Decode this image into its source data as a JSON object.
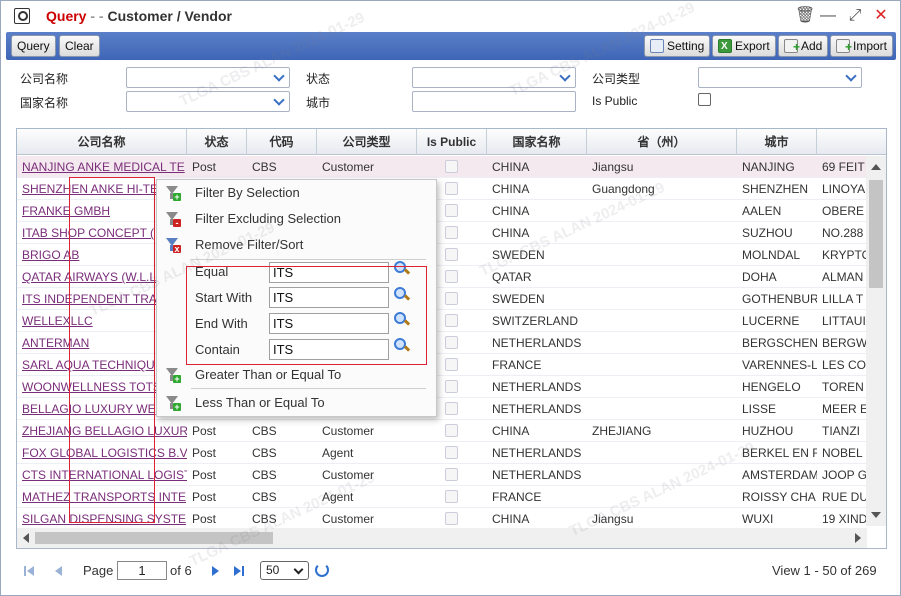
{
  "window": {
    "title_query": "Query",
    "title_sep": "- -",
    "title_rest": "Customer / Vendor",
    "ctrl_trash": "🗑",
    "ctrl_min": "—",
    "ctrl_max": "⤢",
    "ctrl_close": "✕"
  },
  "toolbar": {
    "query": "Query",
    "clear": "Clear",
    "setting": "Setting",
    "export": "Export",
    "add": "Add",
    "import": "Import"
  },
  "filters": {
    "company_name": "公司名称",
    "status": "状态",
    "company_type": "公司类型",
    "country_name": "国家名称",
    "city": "城市",
    "is_public": "Is Public"
  },
  "grid": {
    "columns": [
      "公司名称",
      "状态",
      "代码",
      "公司类型",
      "Is Public",
      "国家名称",
      "省（州）",
      "城市",
      ""
    ],
    "rows": [
      [
        "NANJING ANKE MEDICAL TE",
        "Post",
        "CBS",
        "Customer",
        "",
        "CHINA",
        "Jiangsu",
        "NANJING",
        "69 FEIT"
      ],
      [
        "SHENZHEN ANKE HI-TE",
        "",
        "",
        "",
        "",
        "CHINA",
        "Guangdong",
        "SHENZHEN",
        "LINOYA"
      ],
      [
        "FRANKE GMBH",
        "",
        "",
        "",
        "",
        "CHINA",
        "",
        "AALEN",
        "OBERE"
      ],
      [
        "ITAB SHOP CONCEPT (",
        "",
        "",
        "",
        "",
        "CHINA",
        "",
        "SUZHOU",
        "NO.288"
      ],
      [
        "BRIGO AB",
        "",
        "",
        "",
        "",
        "SWEDEN",
        "",
        "MOLNDAL",
        "KRYPTO"
      ],
      [
        "QATAR AIRWAYS (W.L.L",
        "",
        "",
        "",
        "",
        "QATAR",
        "",
        "DOHA",
        "ALMAN"
      ],
      [
        "ITS INDEPENDENT TRA",
        "",
        "",
        "",
        "",
        "SWEDEN",
        "",
        "GOTHENBUR",
        "LILLA T"
      ],
      [
        "WELLEXLLC",
        "",
        "",
        "",
        "",
        "SWITZERLAND",
        "",
        "LUCERNE",
        "LITTAUI"
      ],
      [
        "ANTERMAN",
        "",
        "",
        "",
        "",
        "NETHERLANDS",
        "",
        "BERGSCHEN",
        "BERGW"
      ],
      [
        "SARL AQUA TECHNIQU",
        "",
        "",
        "",
        "",
        "FRANCE",
        "",
        "VARENNES-L",
        "LES CO"
      ],
      [
        "WOONWELLNESS TOTS",
        "",
        "",
        "",
        "",
        "NETHERLANDS",
        "",
        "HENGELO",
        "TOREN"
      ],
      [
        "BELLAGIO LUXURY WE",
        "",
        "",
        "",
        "",
        "NETHERLANDS",
        "",
        "LISSE",
        "MEER E"
      ],
      [
        "ZHEJIANG BELLAGIO LUXUR",
        "Post",
        "CBS",
        "Customer",
        "",
        "CHINA",
        "ZHEJIANG",
        "HUZHOU",
        "TIANZI"
      ],
      [
        "FOX GLOBAL LOGISTICS B.V",
        "Post",
        "CBS",
        "Agent",
        "",
        "NETHERLANDS",
        "",
        "BERKEL EN F",
        "NOBEL"
      ],
      [
        "CTS INTERNATIONAL LOGIST",
        "Post",
        "CBS",
        "Customer",
        "",
        "NETHERLANDS",
        "",
        "AMSTERDAM",
        "JOOP G"
      ],
      [
        "MATHEZ TRANSPORTS INTE",
        "Post",
        "CBS",
        "Agent",
        "",
        "FRANCE",
        "",
        "ROISSY CHA",
        "RUE DU"
      ],
      [
        "SILGAN DISPENSING SYSTE",
        "Post",
        "CBS",
        "Customer",
        "",
        "CHINA",
        "Jiangsu",
        "WUXI",
        "19 XIND"
      ]
    ]
  },
  "context_menu": {
    "filter_by_selection": "Filter By Selection",
    "filter_excluding_selection": "Filter Excluding Selection",
    "remove_filter_sort": "Remove Filter/Sort",
    "equal": "Equal",
    "start_with": "Start With",
    "end_with": "End With",
    "contain": "Contain",
    "equal_value": "ITS",
    "start_with_value": "ITS",
    "end_with_value": "ITS",
    "contain_value": "ITS",
    "greater_than_or_equal": "Greater Than or Equal To",
    "less_than_or_equal": "Less Than or Equal To"
  },
  "pager": {
    "page_label": "Page",
    "page_value": "1",
    "of_label": "of 6",
    "page_size": "50",
    "view_info": "View 1 - 50 of 269"
  },
  "watermark": "TLGA CBS ALAN 2024-01-29",
  "colors": {
    "toolbar_bg": "#4a70bd",
    "link": "#7a2d7a",
    "highlight_box": "#dd2233",
    "selected_row": "#f4e9ee"
  }
}
